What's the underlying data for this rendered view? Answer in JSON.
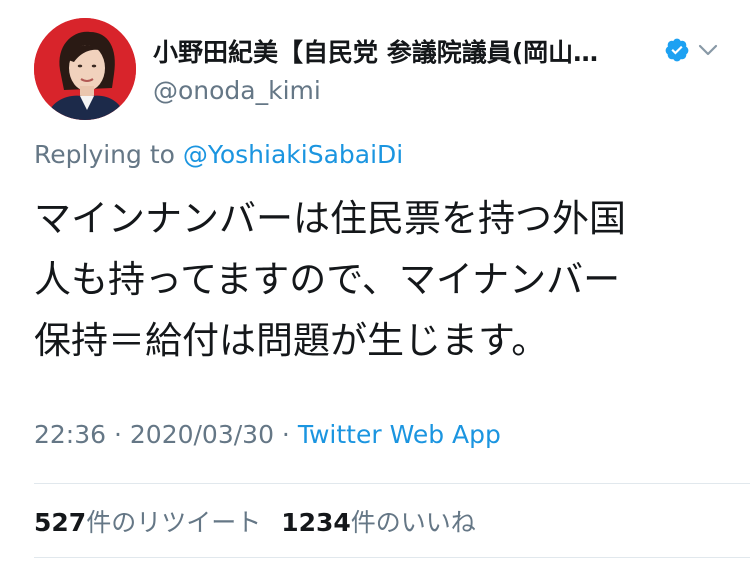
{
  "author": {
    "display_name": "小野田紀美【自民党 参議院議員(岡山…",
    "handle": "@onoda_kimi",
    "verified_icon": "verified-badge-icon",
    "menu_icon": "chevron-down-icon"
  },
  "reply": {
    "prefix": "Replying to ",
    "handle": "@YoshiakiSabaiDi"
  },
  "tweet": {
    "text": "マインナンバーは住民票を持つ外国\n人も持ってますので、マイナンバー\n保持＝給付は問題が生じます。"
  },
  "meta": {
    "time": "22:36",
    "separator": " · ",
    "date": "2020/03/30",
    "separator2": " · ",
    "source": "Twitter Web App"
  },
  "stats": {
    "retweets_count": "527",
    "retweets_label": "件のリツイート",
    "likes_count": "1234",
    "likes_label": "件のいいね"
  },
  "colors": {
    "link": "#1b95e0",
    "secondary": "#657786",
    "primary": "#14171a",
    "divider": "#e1e8ed",
    "avatar_bg": "#d8242b"
  }
}
